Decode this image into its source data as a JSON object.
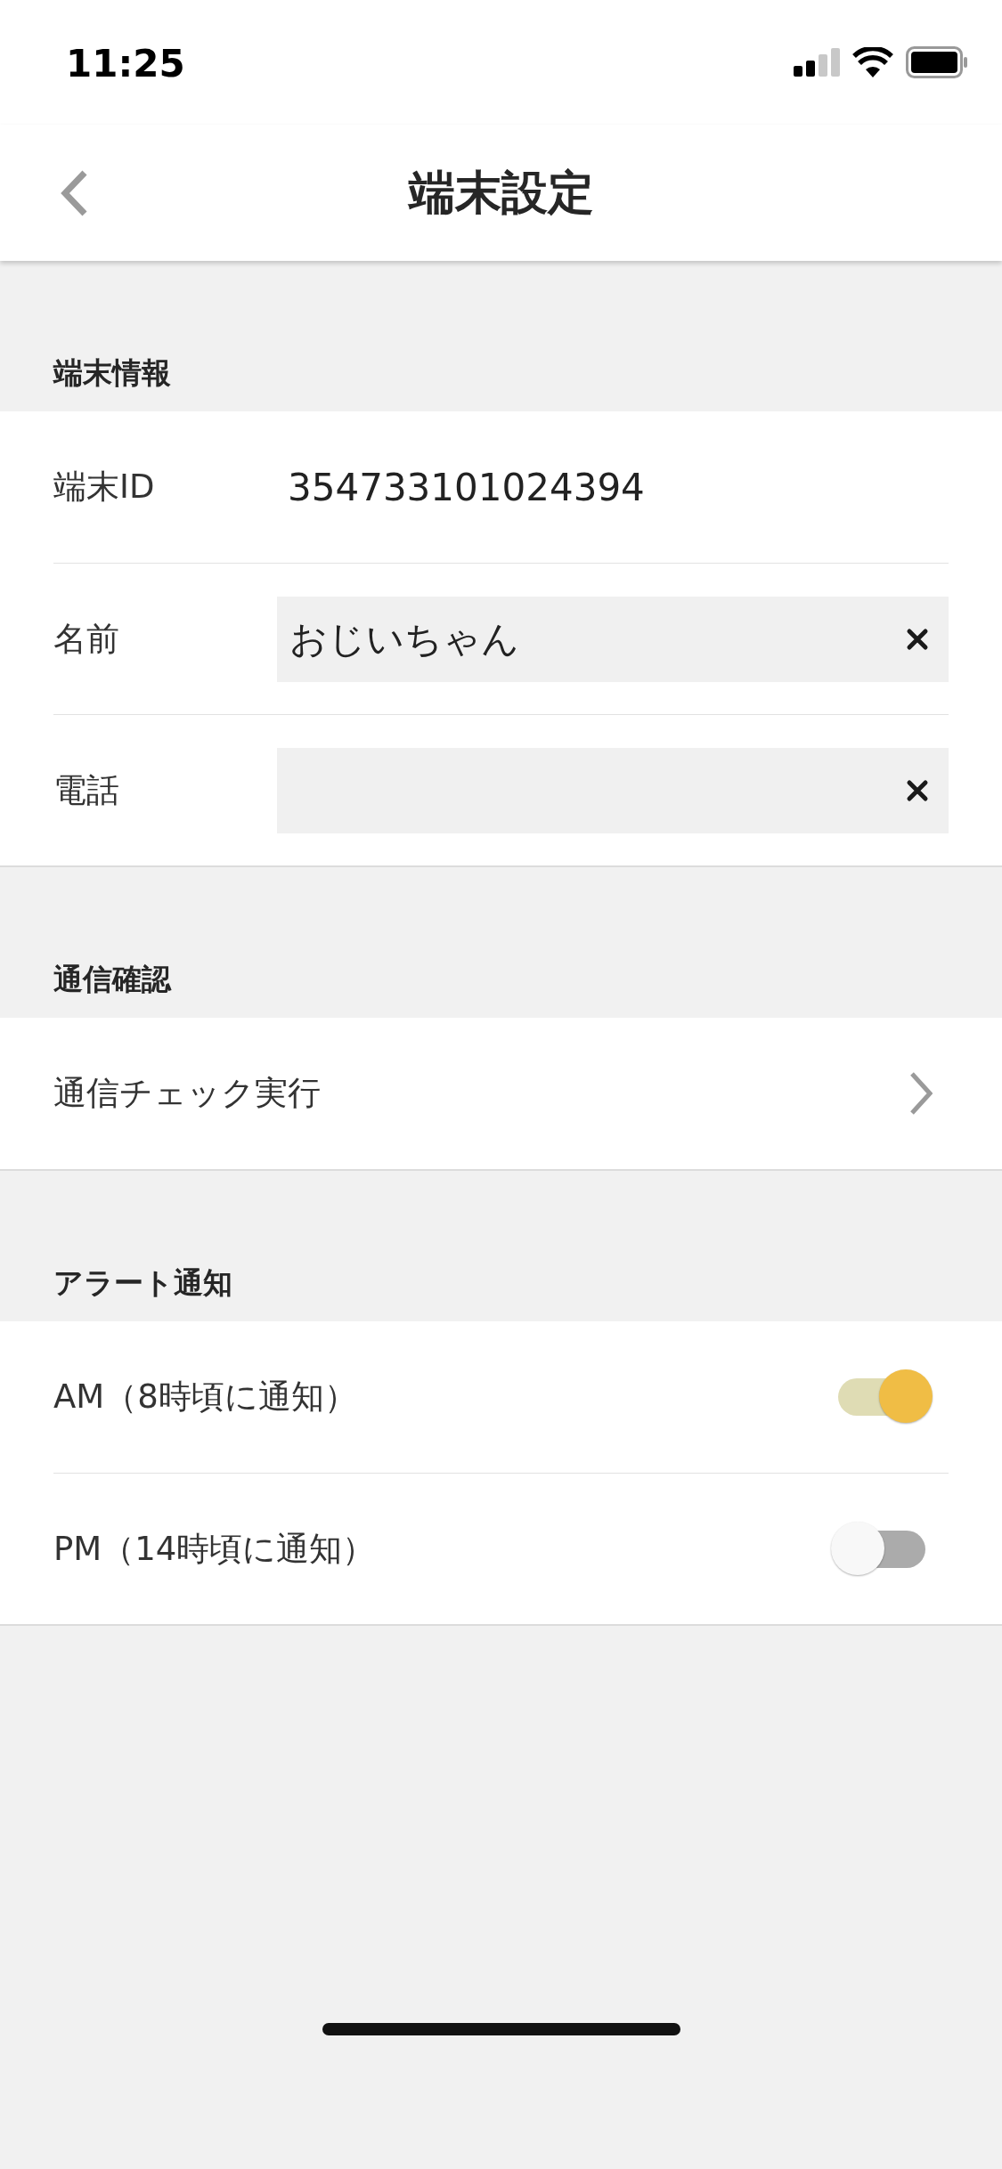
{
  "status_bar": {
    "time": "11:25"
  },
  "nav": {
    "title": "端末設定"
  },
  "sections": [
    {
      "header": "端末情報",
      "rows": [
        {
          "kind": "value",
          "label": "端末ID",
          "value": "354733101024394"
        },
        {
          "kind": "field",
          "label": "名前",
          "value": "おじいちゃん"
        },
        {
          "kind": "field",
          "label": "電話"
        }
      ]
    },
    {
      "header": "通信確認",
      "rows": [
        {
          "kind": "link",
          "label": "通信チェック実行"
        }
      ]
    },
    {
      "header": "アラート通知",
      "rows": [
        {
          "kind": "toggle",
          "label": "AM（8時頃に通知）",
          "on": true
        },
        {
          "kind": "toggle",
          "label": "PM（14時頃に通知）",
          "on": false
        }
      ]
    }
  ]
}
